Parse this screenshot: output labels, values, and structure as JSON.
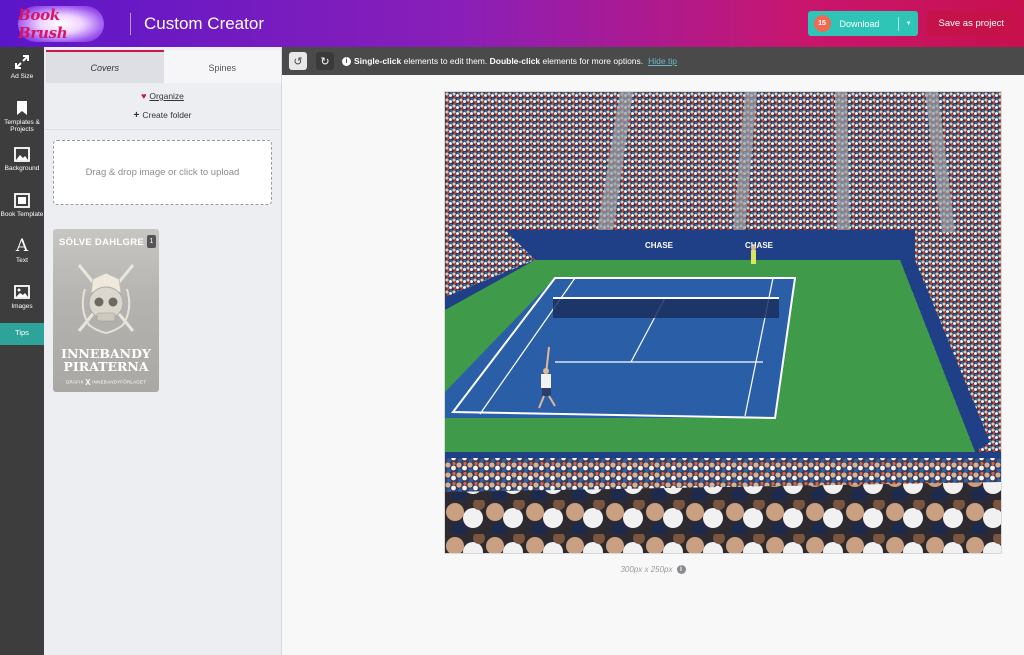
{
  "header": {
    "logo_text": "Book Brush",
    "app_title": "Custom Creator",
    "download_count": "15",
    "download_label": "Download",
    "save_label": "Save as project"
  },
  "rail": {
    "items": [
      {
        "label": "Ad Size",
        "icon": "expand-arrows-icon"
      },
      {
        "label": "Templates & Projects",
        "icon": "bookmark-icon"
      },
      {
        "label": "Background",
        "icon": "background-image-icon"
      },
      {
        "label": "Book Template",
        "icon": "book-template-icon"
      },
      {
        "label": "Text",
        "icon": "text-a-icon"
      },
      {
        "label": "Images",
        "icon": "image-icon"
      },
      {
        "label": "Tips",
        "icon": ""
      }
    ]
  },
  "panel": {
    "tabs": [
      {
        "label": "Covers",
        "active": true
      },
      {
        "label": "Spines",
        "active": false
      }
    ],
    "organize_label": "Organize",
    "create_folder_label": "Create folder",
    "drop_zone_text": "Drag & drop image or click to upload",
    "thumbnail": {
      "author": "SÖLVE DAHLGRE",
      "badge": "1",
      "title_line1": "INNEBANDY",
      "title_line2": "PIRATERNA",
      "footer_left": "GRAFIK",
      "footer_mid": "X",
      "footer_right": "INNEBANDYFÖRLAGET"
    }
  },
  "toolbar": {
    "hint_part1": "Single-click",
    "hint_part2": " elements to edit them. ",
    "hint_part3": "Double-click",
    "hint_part4": " elements for more options.",
    "hide_label": "Hide tip"
  },
  "canvas": {
    "size_label": "300px x 250px",
    "court_banner_text": "CHASE",
    "colors": {
      "court_blue": "#2a5fa8",
      "court_green": "#3f9a4a",
      "wall_blue": "#1f3f86"
    }
  }
}
